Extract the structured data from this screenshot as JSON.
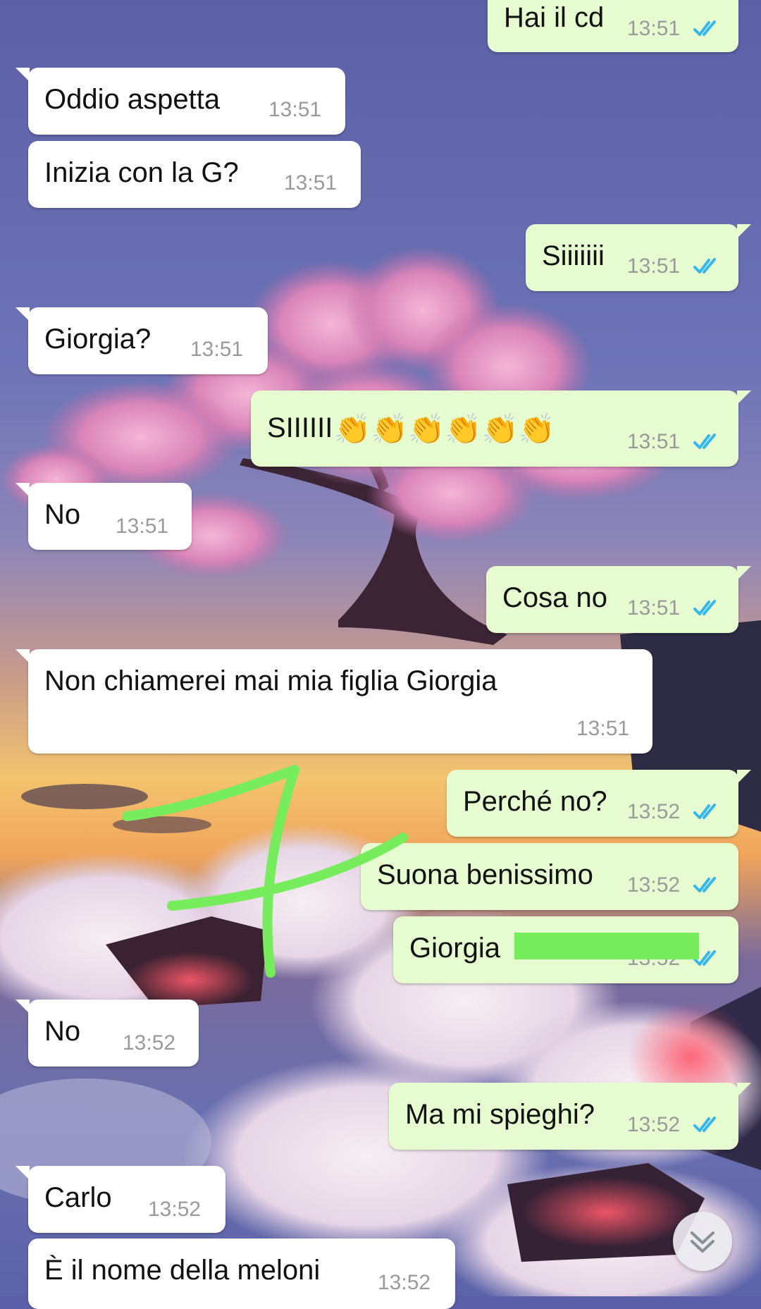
{
  "messages": [
    {
      "id": "m1",
      "direction": "out",
      "text": "Hai il cd",
      "time": "13:51",
      "status": "read"
    },
    {
      "id": "m2",
      "direction": "in",
      "text": "Oddio aspetta",
      "time": "13:51"
    },
    {
      "id": "m3",
      "direction": "in",
      "text": "Inizia con la G?",
      "time": "13:51"
    },
    {
      "id": "m4",
      "direction": "out",
      "text": "Siiiiiii",
      "time": "13:51",
      "status": "read"
    },
    {
      "id": "m5",
      "direction": "in",
      "text": "Giorgia?",
      "time": "13:51"
    },
    {
      "id": "m6",
      "direction": "out",
      "text": "SIIIIII",
      "emoji": "👏👏👏👏👏👏",
      "time": "13:51",
      "status": "read"
    },
    {
      "id": "m7",
      "direction": "in",
      "text": "No",
      "time": "13:51"
    },
    {
      "id": "m8",
      "direction": "out",
      "text": "Cosa no",
      "time": "13:51",
      "status": "read"
    },
    {
      "id": "m9",
      "direction": "in",
      "text": "Non chiamerei mai mia figlia Giorgia",
      "time": "13:51"
    },
    {
      "id": "m10",
      "direction": "out",
      "text": "Perché no?",
      "time": "13:52",
      "status": "read"
    },
    {
      "id": "m11",
      "direction": "out",
      "text": "Suona benissimo",
      "time": "13:52",
      "status": "read"
    },
    {
      "id": "m12",
      "direction": "out",
      "text": "Giorgia",
      "time": "13:52",
      "status": "read",
      "redacted": true
    },
    {
      "id": "m13",
      "direction": "in",
      "text": "No",
      "time": "13:52"
    },
    {
      "id": "m14",
      "direction": "out",
      "text": "Ma mi spieghi?",
      "time": "13:52",
      "status": "read"
    },
    {
      "id": "m15",
      "direction": "in",
      "text": "Carlo",
      "time": "13:52"
    },
    {
      "id": "m16",
      "direction": "in",
      "text": "È il nome della meloni",
      "time": "13:52"
    }
  ],
  "icons": {
    "read_receipt": "double-check-icon",
    "scroll_button": "chevron-double-down-icon"
  },
  "colors": {
    "incoming_bubble": "#ffffff",
    "outgoing_bubble": "#e6fbcf",
    "read_tick": "#34b7f1",
    "timestamp": "#9a9a9a",
    "annotation_marker": "#77ec5c",
    "redaction": "#77ec5c"
  }
}
